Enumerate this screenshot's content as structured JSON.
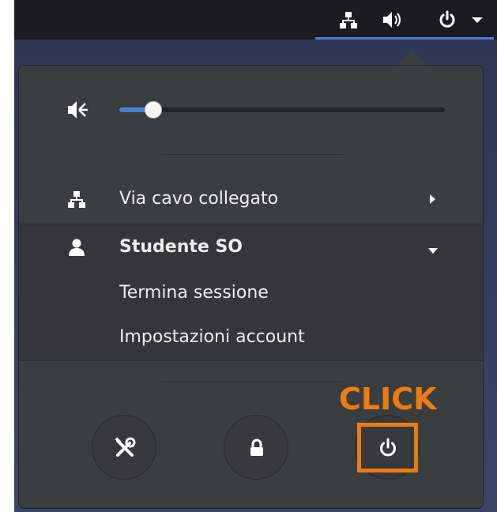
{
  "topbar": {
    "icons": [
      "network-wired-icon",
      "volume-icon",
      "power-icon",
      "menu-down-icon"
    ]
  },
  "volume": {
    "icon": "volume-muted-icon",
    "level": 0.07
  },
  "network": {
    "icon": "network-wired-icon",
    "label": "Via cavo collegato",
    "expand_icon": "chevron-right-icon"
  },
  "user": {
    "icon": "user-icon",
    "name": "Studente SO",
    "expand_icon": "chevron-down-icon",
    "items": [
      {
        "label": "Termina sessione"
      },
      {
        "label": "Impostazioni account"
      }
    ]
  },
  "actions": [
    {
      "name": "settings",
      "icon": "settings-tools-icon"
    },
    {
      "name": "lock",
      "icon": "lock-icon"
    },
    {
      "name": "power-off",
      "icon": "power-icon"
    }
  ],
  "annotation": {
    "label": "CLICK",
    "color": "#f07b10"
  },
  "colors": {
    "accent": "#4a7ed6",
    "menu_bg": "#393e41",
    "text": "#eeeeec"
  }
}
